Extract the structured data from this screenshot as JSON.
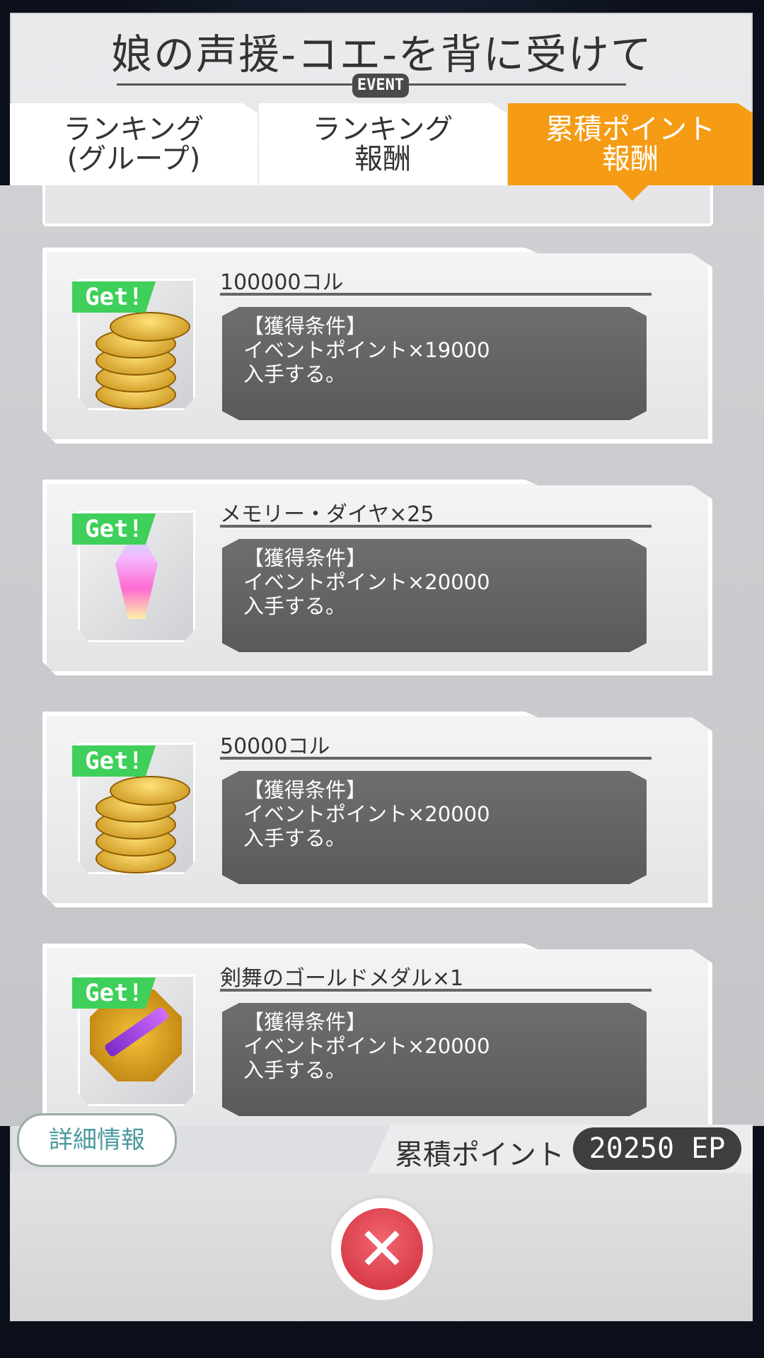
{
  "header": {
    "title": "娘の声援-コエ-を背に受けて",
    "badge": "EVENT"
  },
  "tabs": [
    {
      "line1": "ランキング",
      "line2": "(グループ)",
      "active": false
    },
    {
      "line1": "ランキング",
      "line2": "報酬",
      "active": false
    },
    {
      "line1": "累積ポイント",
      "line2": "報酬",
      "active": true
    }
  ],
  "rewards": [
    {
      "name": "100000コル",
      "badge": "Get!",
      "cond_title": "【獲得条件】",
      "cond_line1": "イベントポイント×19000",
      "cond_line2": "入手する。",
      "icon": "coins-icon"
    },
    {
      "name": "メモリー・ダイヤ×25",
      "badge": "Get!",
      "cond_title": "【獲得条件】",
      "cond_line1": "イベントポイント×20000",
      "cond_line2": "入手する。",
      "icon": "memory-diamond-icon"
    },
    {
      "name": "50000コル",
      "badge": "Get!",
      "cond_title": "【獲得条件】",
      "cond_line1": "イベントポイント×20000",
      "cond_line2": "入手する。",
      "icon": "coins-icon"
    },
    {
      "name": "剣舞のゴールドメダル×1",
      "badge": "Get!",
      "cond_title": "【獲得条件】",
      "cond_line1": "イベントポイント×20000",
      "cond_line2": "入手する。",
      "icon": "gold-medal-icon"
    }
  ],
  "footer": {
    "detail_button": "詳細情報",
    "points_label": "累積ポイント",
    "points_value": "20250 EP",
    "close_symbol": "✕"
  }
}
